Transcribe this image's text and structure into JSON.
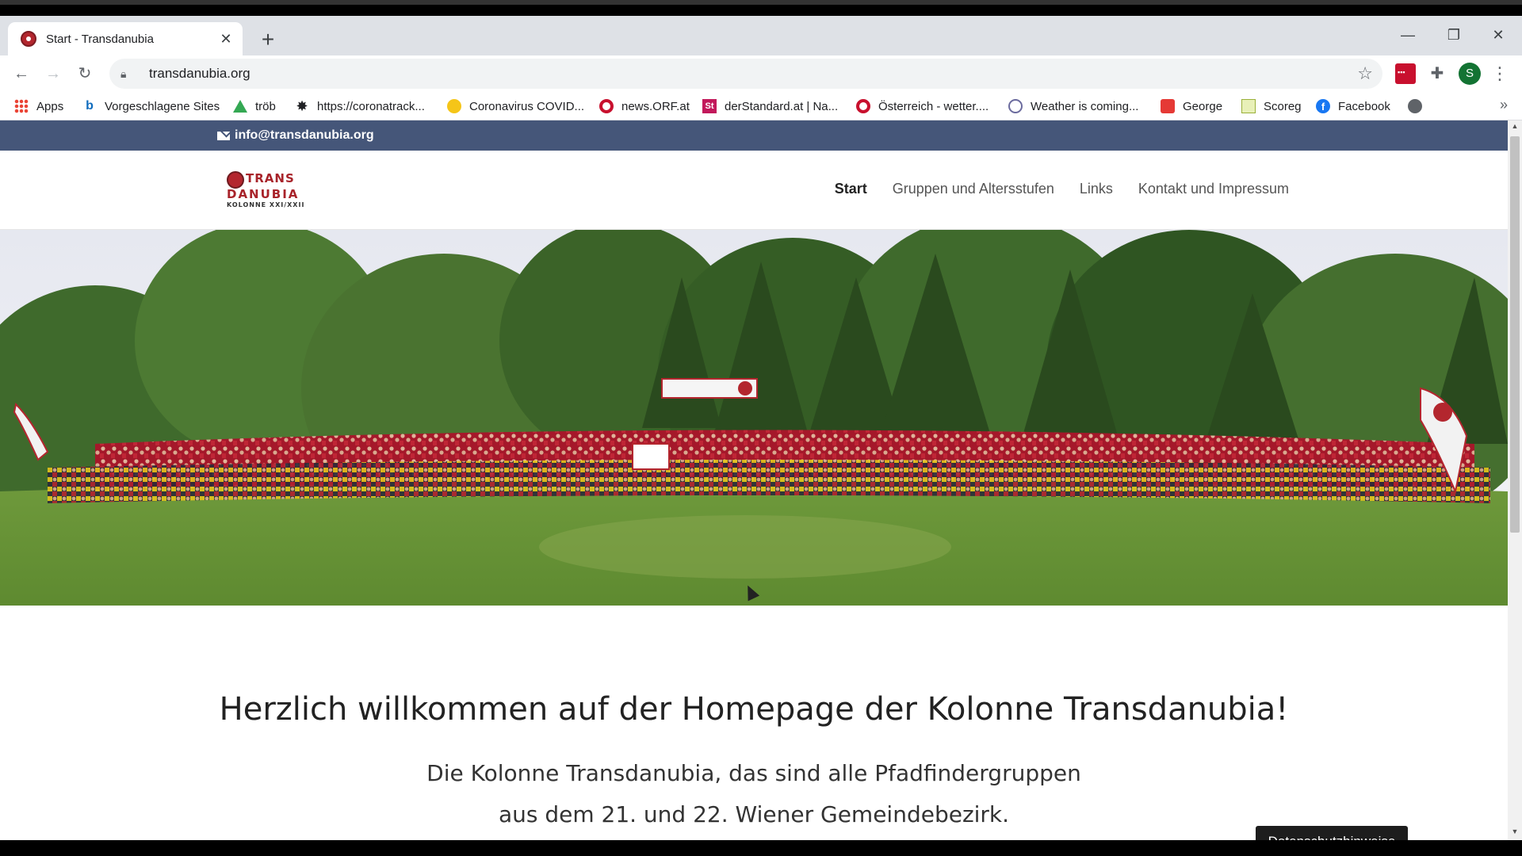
{
  "browser": {
    "tab": {
      "title": "Start - Transdanubia"
    },
    "url": "transdanubia.org",
    "profile_initial": "S",
    "bookmarks": [
      {
        "label": "Apps",
        "icon": "apps-grid-icon"
      },
      {
        "label": "Vorgeschlagene Sites",
        "icon": "bing-icon"
      },
      {
        "label": "tröb",
        "icon": "drive-icon"
      },
      {
        "label": "https://coronatrack...",
        "icon": "gear-icon"
      },
      {
        "label": "Coronavirus COVID...",
        "icon": "covid-icon"
      },
      {
        "label": "news.ORF.at",
        "icon": "orf-icon"
      },
      {
        "label": "derStandard.at | Na...",
        "icon": "derstandard-icon"
      },
      {
        "label": "Österreich - wetter....",
        "icon": "orf-icon"
      },
      {
        "label": "Weather is coming...",
        "icon": "weather-icon"
      },
      {
        "label": "George",
        "icon": "george-icon"
      },
      {
        "label": "Scoreg",
        "icon": "scoreg-icon"
      },
      {
        "label": "Facebook",
        "icon": "facebook-icon"
      }
    ]
  },
  "site": {
    "email": "info@transdanubia.org",
    "logo": {
      "line1": "TRANS",
      "line2": "DANUBIA",
      "line3": "KOLONNE XXI/XXII"
    },
    "nav": [
      "Start",
      "Gruppen und Altersstufen",
      "Links",
      "Kontakt und Impressum"
    ],
    "welcome": "Herzlich willkommen auf der Homepage der Kolonne Transdanubia!",
    "lead_line1": "Die Kolonne Transdanubia, das sind alle Pfadfindergruppen",
    "lead_line2": "aus dem 21. und 22. Wiener Gemeindebezirk.",
    "cookie_label": "Datenschutzhinweise"
  }
}
